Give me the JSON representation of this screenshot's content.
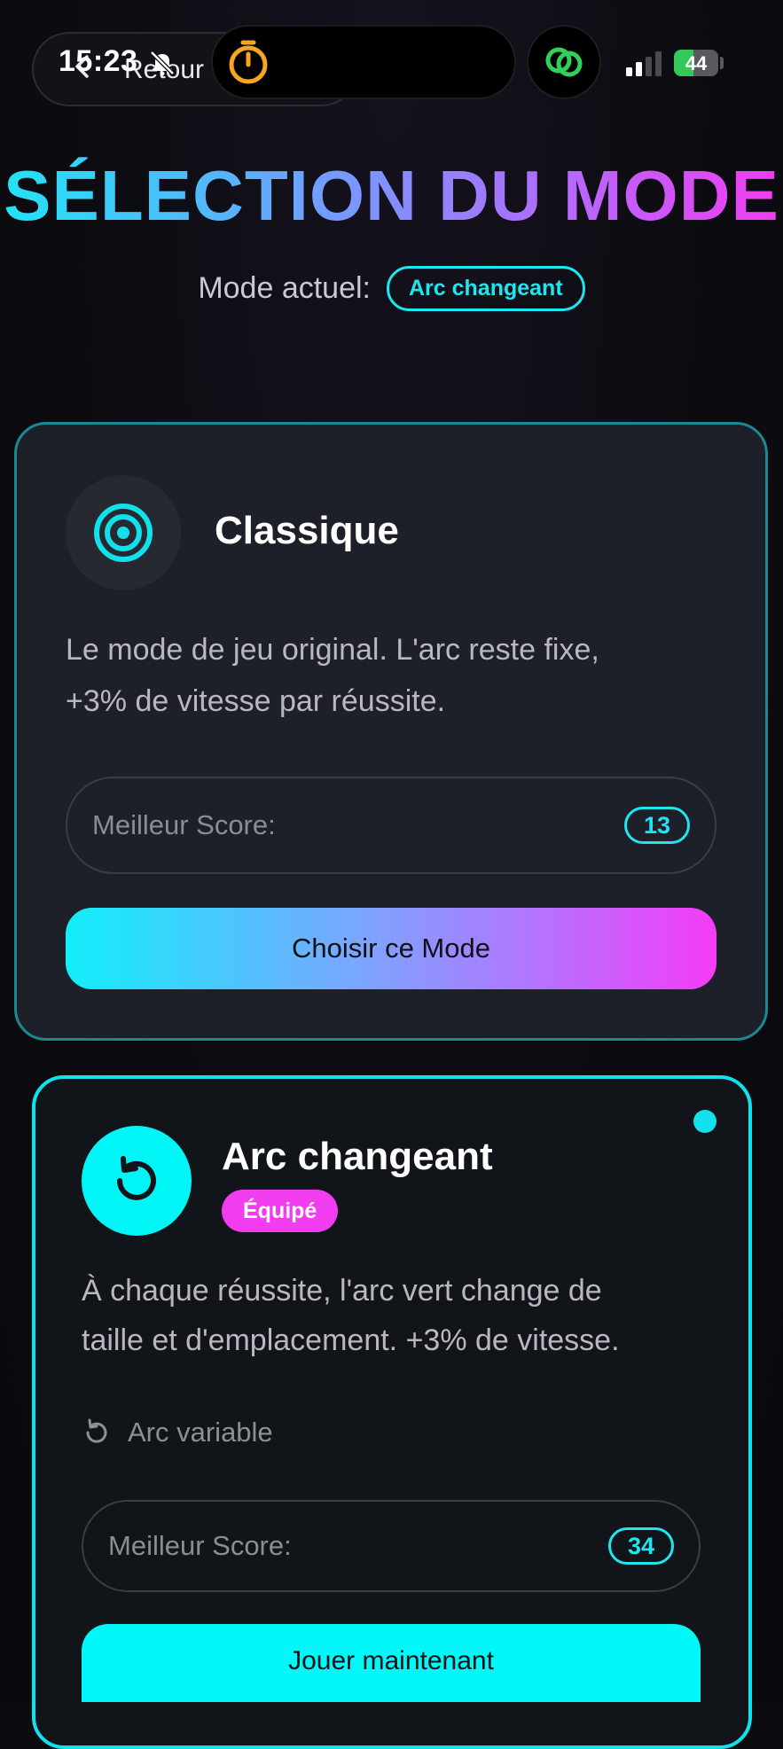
{
  "status_bar": {
    "time": "15:23",
    "battery": "44",
    "battery_level": 0.44
  },
  "nav": {
    "back_label": "Retour"
  },
  "header": {
    "title": "SÉLECTION DU MODE",
    "current_mode_label": "Mode actuel:",
    "current_mode_value": "Arc changeant"
  },
  "modes": [
    {
      "name": "Classique",
      "icon": "target-icon",
      "description_line1": "Le mode de jeu original. L'arc reste fixe,",
      "description_line2": "+3% de vitesse par réussite.",
      "best_score_label": "Meilleur Score:",
      "best_score": "13",
      "button_label": "Choisir ce Mode"
    },
    {
      "name": "Arc changeant",
      "icon": "rotate-icon",
      "badge": "Équipé",
      "description_line1": "À chaque réussite, l'arc vert change de",
      "description_line2": "taille et d'emplacement. +3% de vitesse.",
      "feature": "Arc variable",
      "best_score_label": "Meilleur Score:",
      "best_score": "34",
      "button_label": "Jouer maintenant"
    }
  ],
  "colors": {
    "accent_cyan": "#12e0ea",
    "accent_magenta": "#f23cf0",
    "battery_green": "#34c759",
    "timer_orange": "#f5a623",
    "link_green": "#30d158"
  }
}
